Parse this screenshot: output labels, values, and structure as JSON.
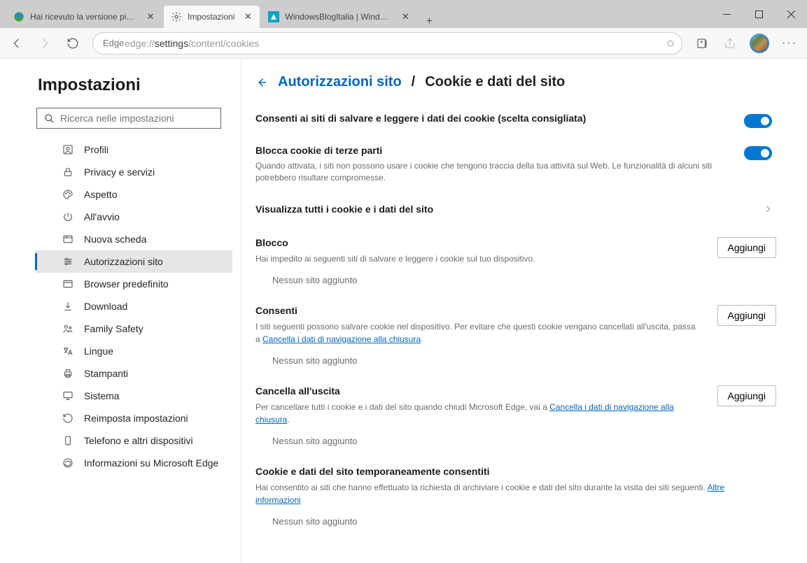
{
  "tabs": [
    {
      "title": "Hai ricevuto la versione più rece"
    },
    {
      "title": "Impostazioni"
    },
    {
      "title": "WindowsBlogItalia | Windows, S"
    }
  ],
  "toolbar": {
    "edge_label": "Edge",
    "url_prefix": "edge://",
    "url_mid": "settings",
    "url_suffix": "/content/cookies"
  },
  "sidebar": {
    "heading": "Impostazioni",
    "search_placeholder": "Ricerca nelle impostazioni",
    "items": [
      {
        "label": "Profili"
      },
      {
        "label": "Privacy e servizi"
      },
      {
        "label": "Aspetto"
      },
      {
        "label": "All'avvio"
      },
      {
        "label": "Nuova scheda"
      },
      {
        "label": "Autorizzazioni sito"
      },
      {
        "label": "Browser predefinito"
      },
      {
        "label": "Download"
      },
      {
        "label": "Family Safety"
      },
      {
        "label": "Lingue"
      },
      {
        "label": "Stampanti"
      },
      {
        "label": "Sistema"
      },
      {
        "label": "Reimposta impostazioni"
      },
      {
        "label": "Telefono e altri dispositivi"
      },
      {
        "label": "Informazioni su Microsoft Edge"
      }
    ]
  },
  "breadcrumb": {
    "link": "Autorizzazioni sito",
    "sep": "/",
    "current": "Cookie e dati del sito"
  },
  "settings": {
    "allow": {
      "label": "Consenti ai siti di salvare e leggere i dati dei cookie (scelta consigliata)"
    },
    "block3p": {
      "label": "Blocca cookie di terze parti",
      "sub": "Quando attivata, i siti non possono usare i cookie che tengono traccia della tua attività sul Web. Le funzionalità di alcuni siti potrebbero risultare compromesse."
    },
    "viewall": "Visualizza tutti i cookie e i dati del sito"
  },
  "sections": {
    "blocco": {
      "title": "Blocco",
      "desc": "Hai impedito ai seguenti siti di salvare e leggere i cookie sul tuo dispositivo.",
      "add": "Aggiungi",
      "empty": "Nessun sito aggiunto"
    },
    "consenti": {
      "title": "Consenti",
      "desc_pre": "I siti seguenti possono salvare cookie nel dispositivo. Per evitare che questi cookie vengano cancellati all'uscita, passa a ",
      "desc_link": "Cancella i dati di navigazione alla chiusura",
      "desc_post": ".",
      "add": "Aggiungi",
      "empty": "Nessun sito aggiunto"
    },
    "cancella": {
      "title": "Cancella all'uscita",
      "desc_pre": "Per cancellare tutti i cookie e i dati del sito quando chiudi Microsoft Edge, vai a ",
      "desc_link": "Cancella i dati di navigazione alla chiusura",
      "desc_post": ".",
      "add": "Aggiungi",
      "empty": "Nessun sito aggiunto"
    },
    "temp": {
      "title": "Cookie e dati del sito temporaneamente consentiti",
      "desc_pre": "Hai consentito ai siti che hanno effettuato la richiesta di archiviare i cookie e dati del sito durante la visita dei siti seguenti. ",
      "desc_link": "Altre informazioni",
      "empty": "Nessun sito aggiunto"
    }
  }
}
